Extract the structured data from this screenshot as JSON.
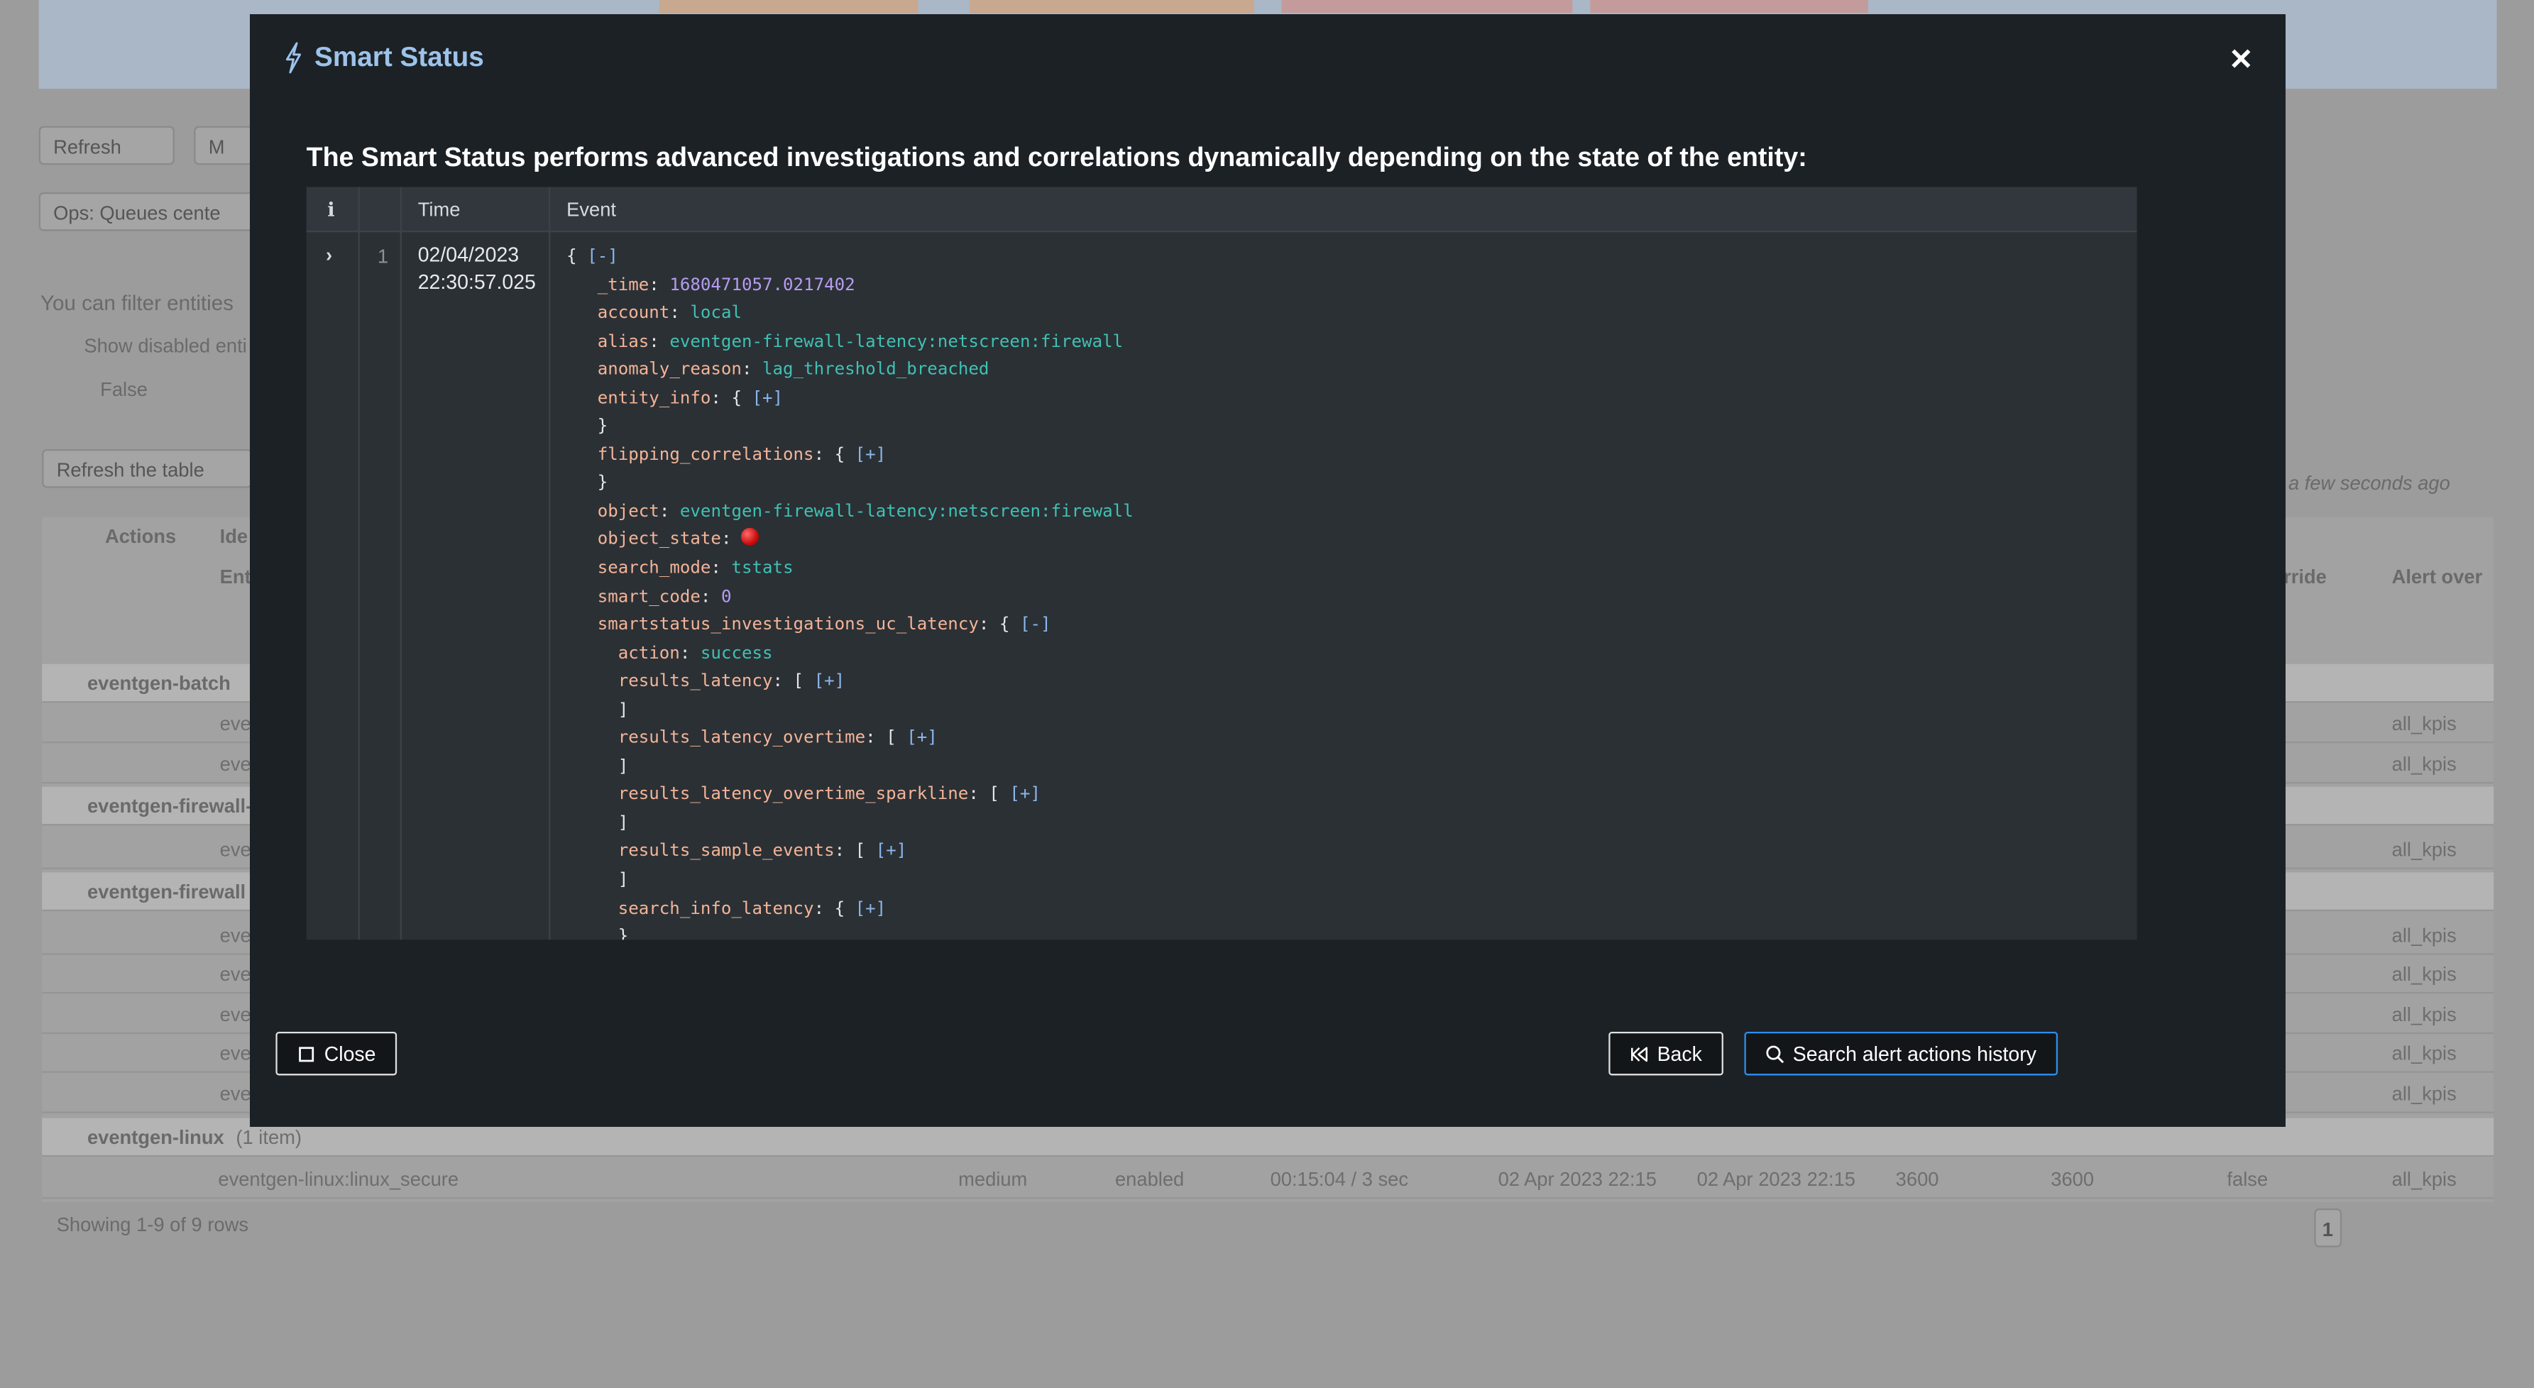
{
  "background": {
    "buttons": [
      "Refresh",
      "M",
      "Ops: Queues cente",
      "Refresh the table"
    ],
    "filter_text": "You can filter entities",
    "show_disabled": "Show disabled enti",
    "false_value": "False",
    "timestamp": "a few seconds ago",
    "columns": [
      "Actions",
      "Ide",
      "Ent",
      "rride",
      "Alert over"
    ],
    "groups": [
      {
        "name": "eventgen-batch",
        "count": "("
      },
      {
        "name": "eventgen-firewall-",
        "count": ""
      },
      {
        "name": "eventgen-firewall",
        "count": "("
      },
      {
        "name": "eventgen-linux",
        "count": "(1 item)"
      }
    ],
    "row_entity": "eve",
    "row_kpis": "all_kpis",
    "linux_row": {
      "entity": "eventgen-linux:linux_secure",
      "priority": "medium",
      "state": "enabled",
      "lag": "00:15:04 / 3 sec",
      "first": "02 Apr 2023 22:15",
      "last": "02 Apr 2023 22:15",
      "t1": "3600",
      "t2": "3600",
      "override": "false",
      "kpis": "all_kpis"
    },
    "showing": "Showing 1-9 of 9 rows",
    "page": "1"
  },
  "modal": {
    "title": "Smart Status",
    "close_x": "✕",
    "lead": "The Smart Status performs advanced investigations and correlations dynamically depending on the state of the entity:",
    "table": {
      "headers": {
        "info": "i",
        "time": "Time",
        "event": "Event"
      },
      "row_number": "1",
      "expander": "›",
      "time_date": "02/04/2023",
      "time_clock": "22:30:57.025"
    },
    "event": {
      "open_brace": "{",
      "collapse": "[-]",
      "expand": "[+]",
      "fields": {
        "_time": "1680471057.0217402",
        "account": "local",
        "alias": "eventgen-firewall-latency:netscreen:firewall",
        "anomaly_reason": "lag_threshold_breached",
        "object": "eventgen-firewall-latency:netscreen:firewall",
        "search_mode": "tstats",
        "smart_code": "0",
        "action": "success"
      }
    },
    "buttons": {
      "close": "Close",
      "back": "Back",
      "search": "Search alert actions history"
    }
  }
}
